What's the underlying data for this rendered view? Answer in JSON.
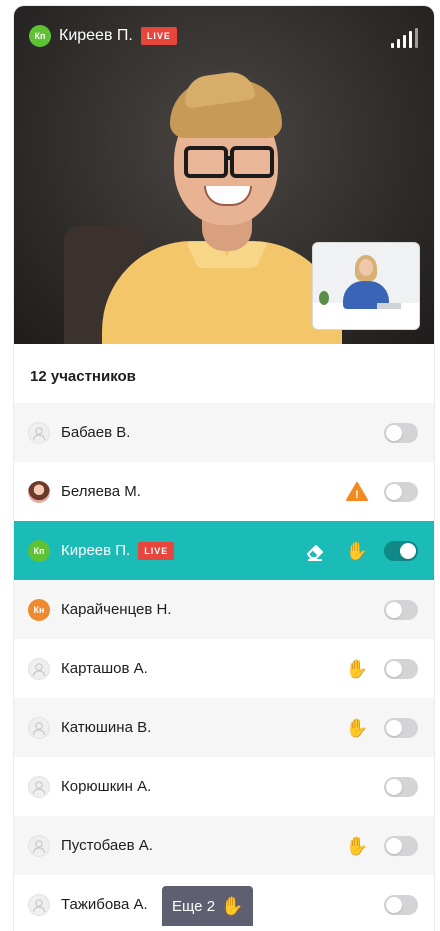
{
  "video": {
    "speaker_initials": "Кп",
    "speaker_name": "Киреев П.",
    "live_label": "LIVE",
    "signal_icon": "signal-strength-icon"
  },
  "colors": {
    "accent_teal": "#1bbcb7",
    "toggle_on": "#0f8a86",
    "live_red": "#e8453c",
    "avatar_green": "#5ec234",
    "avatar_orange": "#ef8a2e",
    "warning_orange": "#f28b1f"
  },
  "participants": {
    "count_label": "12 участников",
    "items": [
      {
        "name": "Бабаев В.",
        "avatar": "user-placeholder-icon",
        "toggle": false
      },
      {
        "name": "Беляева М.",
        "avatar": "photo",
        "warning": true,
        "toggle": false
      },
      {
        "name": "Киреев П.",
        "initials": "Кп",
        "live": "LIVE",
        "eraser": true,
        "hand_raised": true,
        "toggle": true
      },
      {
        "name": "Карайченцев Н.",
        "initials": "Кн",
        "toggle": false
      },
      {
        "name": "Карташов А.",
        "avatar": "user-placeholder-icon",
        "hand_raised": true,
        "toggle": false
      },
      {
        "name": "Катюшина В.",
        "avatar": "user-placeholder-icon",
        "hand_raised": true,
        "toggle": false
      },
      {
        "name": "Корюшкин А.",
        "avatar": "user-placeholder-icon",
        "toggle": false
      },
      {
        "name": "Пустобаев А.",
        "avatar": "user-placeholder-icon",
        "hand_raised": true,
        "toggle": false
      },
      {
        "name": "Тажибова А.",
        "avatar": "user-placeholder-icon",
        "toggle": false
      }
    ],
    "more_label": "Еще 2",
    "hand_glyph": "✋",
    "warning_glyph": "!"
  }
}
